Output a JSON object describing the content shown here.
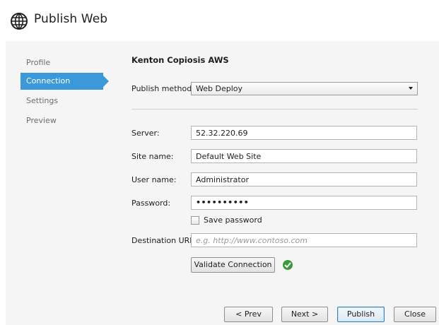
{
  "window": {
    "title": "Publish Web"
  },
  "nav": {
    "items": [
      {
        "label": "Profile"
      },
      {
        "label": "Connection"
      },
      {
        "label": "Settings"
      },
      {
        "label": "Preview"
      }
    ],
    "active": "Connection"
  },
  "connection": {
    "profile_name": "Kenton Copiosis AWS",
    "publish_method": {
      "label": "Publish method:",
      "value": "Web Deploy"
    },
    "server": {
      "label": "Server:",
      "value": "52.32.220.69"
    },
    "site_name": {
      "label": "Site name:",
      "value": "Default Web Site"
    },
    "user_name": {
      "label": "User name:",
      "value": "Administrator"
    },
    "password": {
      "label": "Password:",
      "value": "••••••••••"
    },
    "save_password": {
      "label": "Save password",
      "checked": false
    },
    "destination_url": {
      "label": "Destination URL:",
      "value": "",
      "placeholder": "e.g. http://www.contoso.com"
    },
    "validate_button": "Validate Connection",
    "validation_status": "success"
  },
  "footer": {
    "prev": "< Prev",
    "next": "Next >",
    "publish": "Publish",
    "close": "Close"
  },
  "colors": {
    "accent": "#3b99d9",
    "success": "#3a9a3a"
  }
}
